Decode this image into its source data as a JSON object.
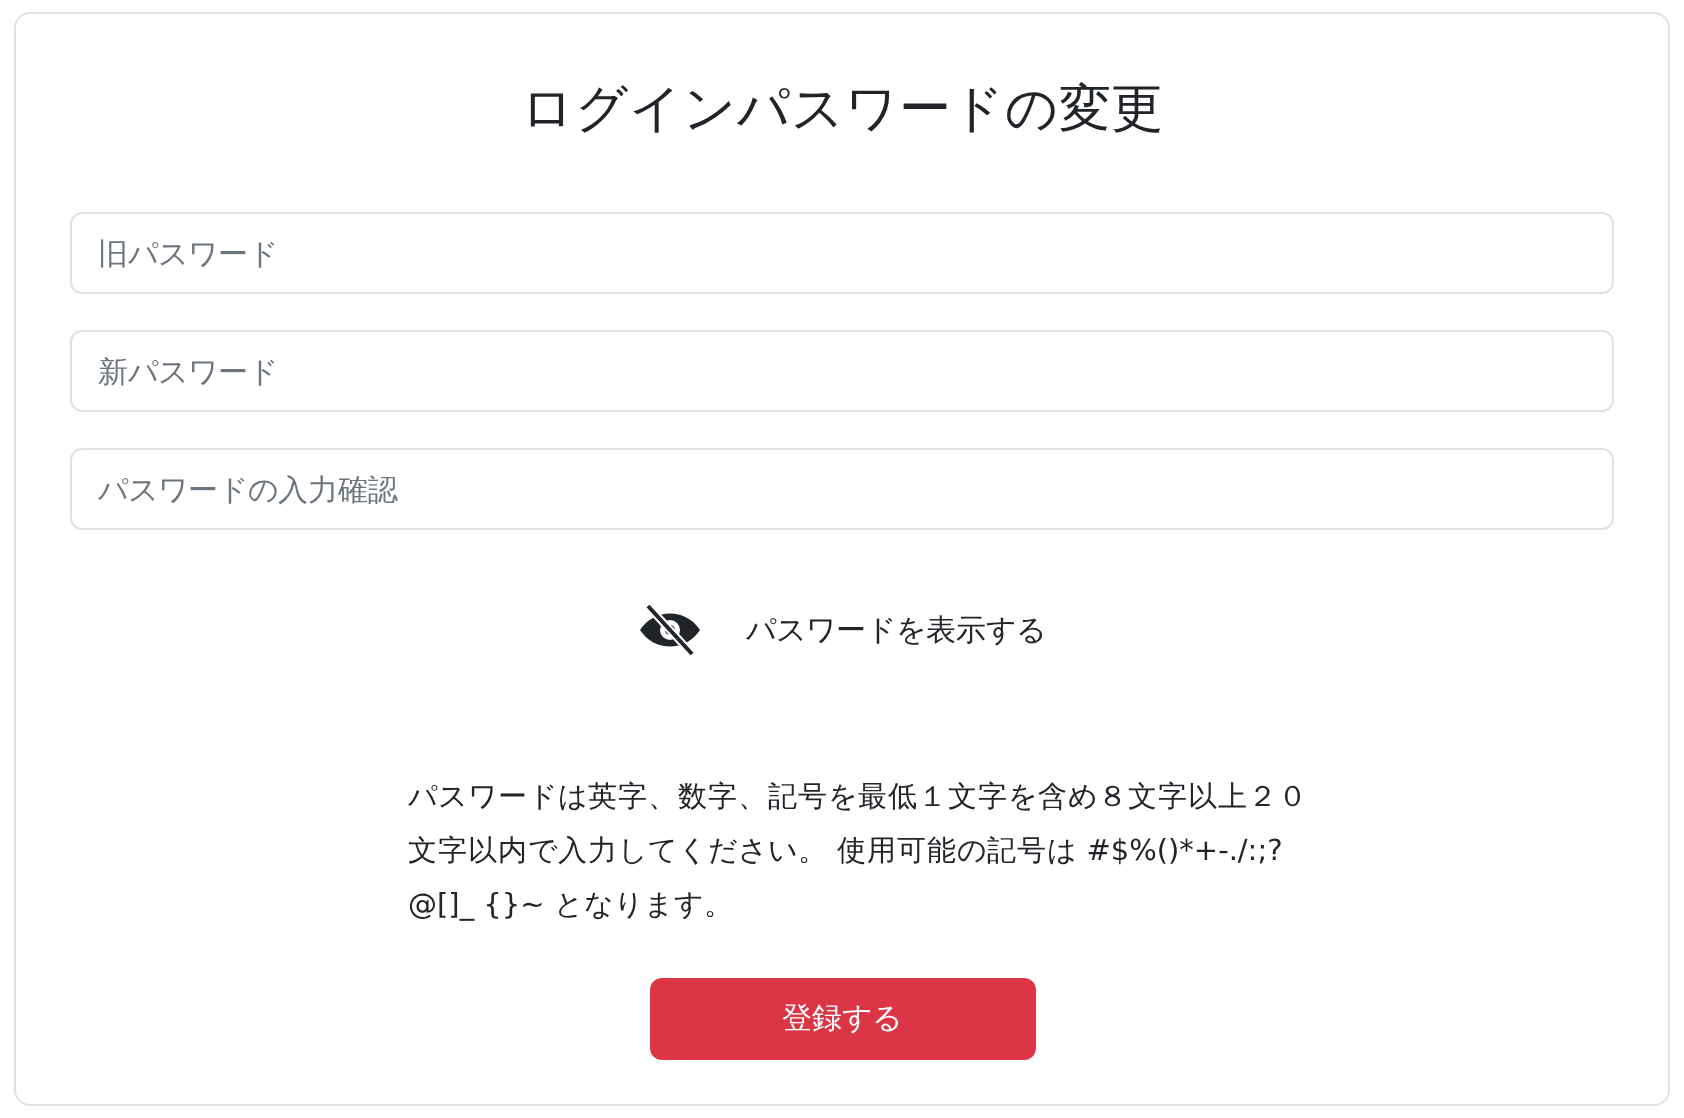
{
  "title": "ログインパスワードの変更",
  "fields": [
    {
      "placeholder": "旧パスワード"
    },
    {
      "placeholder": "新パスワード"
    },
    {
      "placeholder": "パスワードの入力確認"
    }
  ],
  "show_password": {
    "label": "パスワードを表示する",
    "shown": false
  },
  "note": "パスワードは英字、数字、記号を最低１文字を含め８文字以上２０文字以内で入力してください。 使用可能の記号は #$%()*+-./:;?@[]_ {}~ となります。",
  "submit_button": "登録する"
}
